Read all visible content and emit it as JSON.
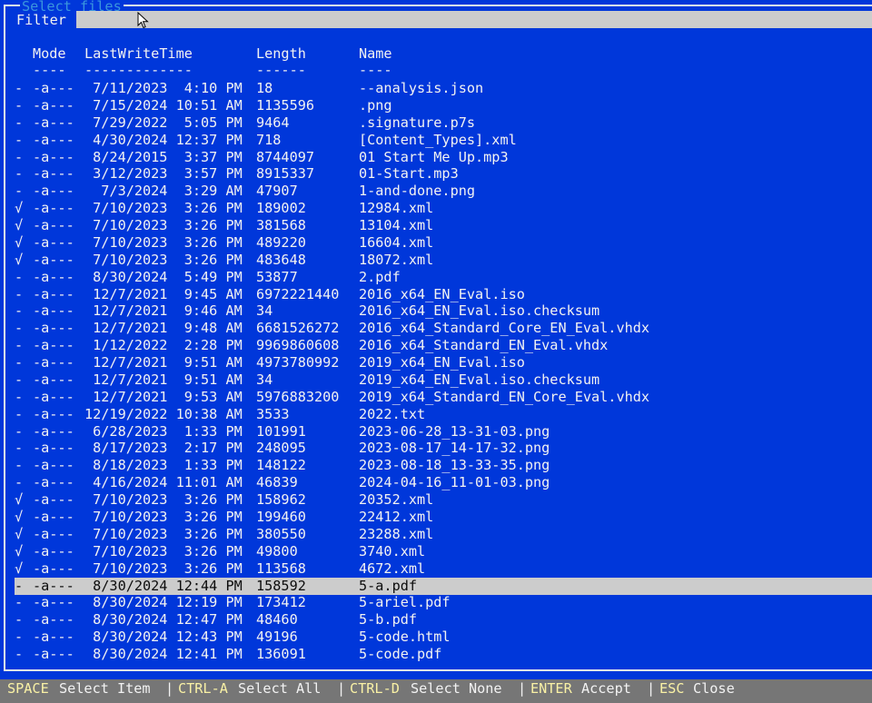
{
  "dialog": {
    "title": "Select files"
  },
  "filter": {
    "label": "Filter",
    "value": ""
  },
  "columns": {
    "mode": "Mode",
    "mode_ul": "----",
    "time": "LastWriteTime",
    "time_ul": "-------------",
    "length": "Length",
    "length_ul": "------",
    "name": "Name",
    "name_ul": "----"
  },
  "rows": [
    {
      "mark": "-",
      "mode": "-a---",
      "time": " 7/11/2023  4:10 PM",
      "length": "18",
      "name": "--analysis.json"
    },
    {
      "mark": "-",
      "mode": "-a---",
      "time": " 7/15/2024 10:51 AM",
      "length": "1135596",
      "name": ".png"
    },
    {
      "mark": "-",
      "mode": "-a---",
      "time": " 7/29/2022  5:05 PM",
      "length": "9464",
      "name": ".signature.p7s"
    },
    {
      "mark": "-",
      "mode": "-a---",
      "time": " 4/30/2024 12:37 PM",
      "length": "718",
      "name": "[Content_Types].xml"
    },
    {
      "mark": "-",
      "mode": "-a---",
      "time": " 8/24/2015  3:37 PM",
      "length": "8744097",
      "name": "01 Start Me Up.mp3"
    },
    {
      "mark": "-",
      "mode": "-a---",
      "time": " 3/12/2023  3:57 PM",
      "length": "8915337",
      "name": "01-Start.mp3"
    },
    {
      "mark": "-",
      "mode": "-a---",
      "time": "  7/3/2024  3:29 AM",
      "length": "47907",
      "name": "1-and-done.png"
    },
    {
      "mark": "√",
      "mode": "-a---",
      "time": " 7/10/2023  3:26 PM",
      "length": "189002",
      "name": "12984.xml"
    },
    {
      "mark": "√",
      "mode": "-a---",
      "time": " 7/10/2023  3:26 PM",
      "length": "381568",
      "name": "13104.xml"
    },
    {
      "mark": "√",
      "mode": "-a---",
      "time": " 7/10/2023  3:26 PM",
      "length": "489220",
      "name": "16604.xml"
    },
    {
      "mark": "√",
      "mode": "-a---",
      "time": " 7/10/2023  3:26 PM",
      "length": "483648",
      "name": "18072.xml"
    },
    {
      "mark": "-",
      "mode": "-a---",
      "time": " 8/30/2024  5:49 PM",
      "length": "53877",
      "name": "2.pdf"
    },
    {
      "mark": "-",
      "mode": "-a---",
      "time": " 12/7/2021  9:45 AM",
      "length": "6972221440",
      "name": "2016_x64_EN_Eval.iso"
    },
    {
      "mark": "-",
      "mode": "-a---",
      "time": " 12/7/2021  9:46 AM",
      "length": "34",
      "name": "2016_x64_EN_Eval.iso.checksum"
    },
    {
      "mark": "-",
      "mode": "-a---",
      "time": " 12/7/2021  9:48 AM",
      "length": "6681526272",
      "name": "2016_x64_Standard_Core_EN_Eval.vhdx"
    },
    {
      "mark": "-",
      "mode": "-a---",
      "time": " 1/12/2022  2:28 PM",
      "length": "9969860608",
      "name": "2016_x64_Standard_EN_Eval.vhdx"
    },
    {
      "mark": "-",
      "mode": "-a---",
      "time": " 12/7/2021  9:51 AM",
      "length": "4973780992",
      "name": "2019_x64_EN_Eval.iso"
    },
    {
      "mark": "-",
      "mode": "-a---",
      "time": " 12/7/2021  9:51 AM",
      "length": "34",
      "name": "2019_x64_EN_Eval.iso.checksum"
    },
    {
      "mark": "-",
      "mode": "-a---",
      "time": " 12/7/2021  9:53 AM",
      "length": "5976883200",
      "name": "2019_x64_Standard_EN_Core_Eval.vhdx"
    },
    {
      "mark": "-",
      "mode": "-a---",
      "time": "12/19/2022 10:38 AM",
      "length": "3533",
      "name": "2022.txt"
    },
    {
      "mark": "-",
      "mode": "-a---",
      "time": " 6/28/2023  1:33 PM",
      "length": "101991",
      "name": "2023-06-28_13-31-03.png"
    },
    {
      "mark": "-",
      "mode": "-a---",
      "time": " 8/17/2023  2:17 PM",
      "length": "248095",
      "name": "2023-08-17_14-17-32.png"
    },
    {
      "mark": "-",
      "mode": "-a---",
      "time": " 8/18/2023  1:33 PM",
      "length": "148122",
      "name": "2023-08-18_13-33-35.png"
    },
    {
      "mark": "-",
      "mode": "-a---",
      "time": " 4/16/2024 11:01 AM",
      "length": "46839",
      "name": "2024-04-16_11-01-03.png"
    },
    {
      "mark": "√",
      "mode": "-a---",
      "time": " 7/10/2023  3:26 PM",
      "length": "158962",
      "name": "20352.xml"
    },
    {
      "mark": "√",
      "mode": "-a---",
      "time": " 7/10/2023  3:26 PM",
      "length": "199460",
      "name": "22412.xml"
    },
    {
      "mark": "√",
      "mode": "-a---",
      "time": " 7/10/2023  3:26 PM",
      "length": "380550",
      "name": "23288.xml"
    },
    {
      "mark": "√",
      "mode": "-a---",
      "time": " 7/10/2023  3:26 PM",
      "length": "49800",
      "name": "3740.xml"
    },
    {
      "mark": "√",
      "mode": "-a---",
      "time": " 7/10/2023  3:26 PM",
      "length": "113568",
      "name": "4672.xml"
    },
    {
      "mark": "-",
      "mode": "-a---",
      "time": " 8/30/2024 12:44 PM",
      "length": "158592",
      "name": "5-a.pdf",
      "highlighted": true
    },
    {
      "mark": "-",
      "mode": "-a---",
      "time": " 8/30/2024 12:19 PM",
      "length": "173412",
      "name": "5-ariel.pdf"
    },
    {
      "mark": "-",
      "mode": "-a---",
      "time": " 8/30/2024 12:47 PM",
      "length": "48460",
      "name": "5-b.pdf"
    },
    {
      "mark": "-",
      "mode": "-a---",
      "time": " 8/30/2024 12:43 PM",
      "length": "49196",
      "name": "5-code.html"
    },
    {
      "mark": "-",
      "mode": "-a---",
      "time": " 8/30/2024 12:41 PM",
      "length": "136091",
      "name": "5-code.pdf"
    }
  ],
  "statusbar": {
    "separator": "|",
    "items": [
      {
        "key": "SPACE",
        "label": "Select Item"
      },
      {
        "key": "CTRL-A",
        "label": "Select All"
      },
      {
        "key": "CTRL-D",
        "label": "Select None"
      },
      {
        "key": "ENTER",
        "label": "Accept"
      },
      {
        "key": "ESC",
        "label": "Close"
      }
    ]
  },
  "colors": {
    "background": "#0037da",
    "title": "#3a96dd",
    "selection": "#cccccc",
    "statusbar": "#767676",
    "hotkey": "#f9f1a5"
  }
}
